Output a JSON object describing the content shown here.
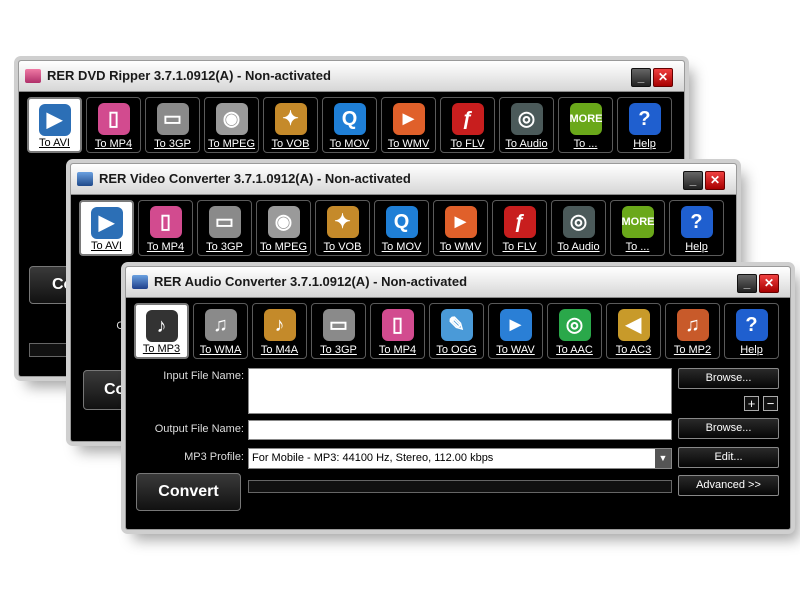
{
  "windows": {
    "dvd": {
      "title": "RER DVD Ripper 3.7.1.0912(A) - Non-activated",
      "tools": [
        {
          "label": "To AVI",
          "icon": "film-reel-icon",
          "color": "#2c6fb6",
          "glyph": "▶"
        },
        {
          "label": "To MP4",
          "icon": "ipod-icon",
          "color": "#d24b8f",
          "glyph": "▯"
        },
        {
          "label": "To 3GP",
          "icon": "mobile-phone-icon",
          "color": "#8a8a8a",
          "glyph": "▭"
        },
        {
          "label": "To MPEG",
          "icon": "film-reel-icon",
          "color": "#9a9a9a",
          "glyph": "◉"
        },
        {
          "label": "To VOB",
          "icon": "clapper-icon",
          "color": "#c58a2a",
          "glyph": "✦"
        },
        {
          "label": "To MOV",
          "icon": "quicktime-icon",
          "color": "#1f7fd6",
          "glyph": "Q"
        },
        {
          "label": "To WMV",
          "icon": "windows-media-icon",
          "color": "#e0602a",
          "glyph": "►"
        },
        {
          "label": "To FLV",
          "icon": "flash-icon",
          "color": "#c81e1e",
          "glyph": "ƒ"
        },
        {
          "label": "To Audio",
          "icon": "speaker-icon",
          "color": "#4b5a5a",
          "glyph": "◎"
        },
        {
          "label": "To ...",
          "icon": "more-icon",
          "color": "#6aa81a",
          "glyph": "MORE"
        },
        {
          "label": "Help",
          "icon": "help-icon",
          "color": "#1f5fcf",
          "glyph": "?"
        }
      ]
    },
    "video": {
      "title": "RER Video Converter 3.7.1.0912(A) - Non-activated",
      "tools": [
        {
          "label": "To AVI",
          "icon": "film-reel-icon",
          "color": "#2c6fb6",
          "glyph": "▶"
        },
        {
          "label": "To MP4",
          "icon": "ipod-icon",
          "color": "#d24b8f",
          "glyph": "▯"
        },
        {
          "label": "To 3GP",
          "icon": "mobile-phone-icon",
          "color": "#8a8a8a",
          "glyph": "▭"
        },
        {
          "label": "To MPEG",
          "icon": "film-reel-icon",
          "color": "#9a9a9a",
          "glyph": "◉"
        },
        {
          "label": "To VOB",
          "icon": "clapper-icon",
          "color": "#c58a2a",
          "glyph": "✦"
        },
        {
          "label": "To MOV",
          "icon": "quicktime-icon",
          "color": "#1f7fd6",
          "glyph": "Q"
        },
        {
          "label": "To WMV",
          "icon": "windows-media-icon",
          "color": "#e0602a",
          "glyph": "►"
        },
        {
          "label": "To FLV",
          "icon": "flash-icon",
          "color": "#c81e1e",
          "glyph": "ƒ"
        },
        {
          "label": "To Audio",
          "icon": "speaker-icon",
          "color": "#4b5a5a",
          "glyph": "◎"
        },
        {
          "label": "To ...",
          "icon": "more-icon",
          "color": "#6aa81a",
          "glyph": "MORE"
        },
        {
          "label": "Help",
          "icon": "help-icon",
          "color": "#1f5fcf",
          "glyph": "?"
        }
      ]
    },
    "audio": {
      "title": "RER Audio Converter 3.7.1.0912(A) - Non-activated",
      "tools": [
        {
          "label": "To MP3",
          "icon": "mp3-player-icon",
          "color": "#333333",
          "glyph": "♪"
        },
        {
          "label": "To WMA",
          "icon": "music-disc-icon",
          "color": "#8a8a8a",
          "glyph": "♫"
        },
        {
          "label": "To M4A",
          "icon": "apple-icon",
          "color": "#c48a2a",
          "glyph": "♪"
        },
        {
          "label": "To 3GP",
          "icon": "mobile-phone-icon",
          "color": "#8a8a8a",
          "glyph": "▭"
        },
        {
          "label": "To MP4",
          "icon": "ipod-icon",
          "color": "#d24b8f",
          "glyph": "▯"
        },
        {
          "label": "To OGG",
          "icon": "microphone-icon",
          "color": "#4a9ad8",
          "glyph": "✎"
        },
        {
          "label": "To WAV",
          "icon": "play-circle-icon",
          "color": "#2a7fd6",
          "glyph": "►"
        },
        {
          "label": "To AAC",
          "icon": "speaker-icon",
          "color": "#2aa84a",
          "glyph": "◎"
        },
        {
          "label": "To AC3",
          "icon": "speaker-icon",
          "color": "#c89a2a",
          "glyph": "◀"
        },
        {
          "label": "To MP2",
          "icon": "music-note-icon",
          "color": "#c85a2a",
          "glyph": "♫"
        },
        {
          "label": "Help",
          "icon": "help-icon",
          "color": "#1f5fcf",
          "glyph": "?"
        }
      ],
      "input_label": "Input File Name:",
      "output_label": "Output File Name:",
      "profile_label": "MP3 Profile:",
      "profile_value": "For Mobile - MP3: 44100 Hz, Stereo, 112.00 kbps",
      "browse_label": "Browse...",
      "plus_label": "+",
      "minus_label": "−",
      "edit_label": "Edit...",
      "advanced_label": "Advanced >>",
      "convert_label": "Convert"
    },
    "partial": {
      "video_in": "In",
      "video_out": "Ou",
      "video_conv": "Co",
      "dvd_conv": "Co"
    }
  }
}
